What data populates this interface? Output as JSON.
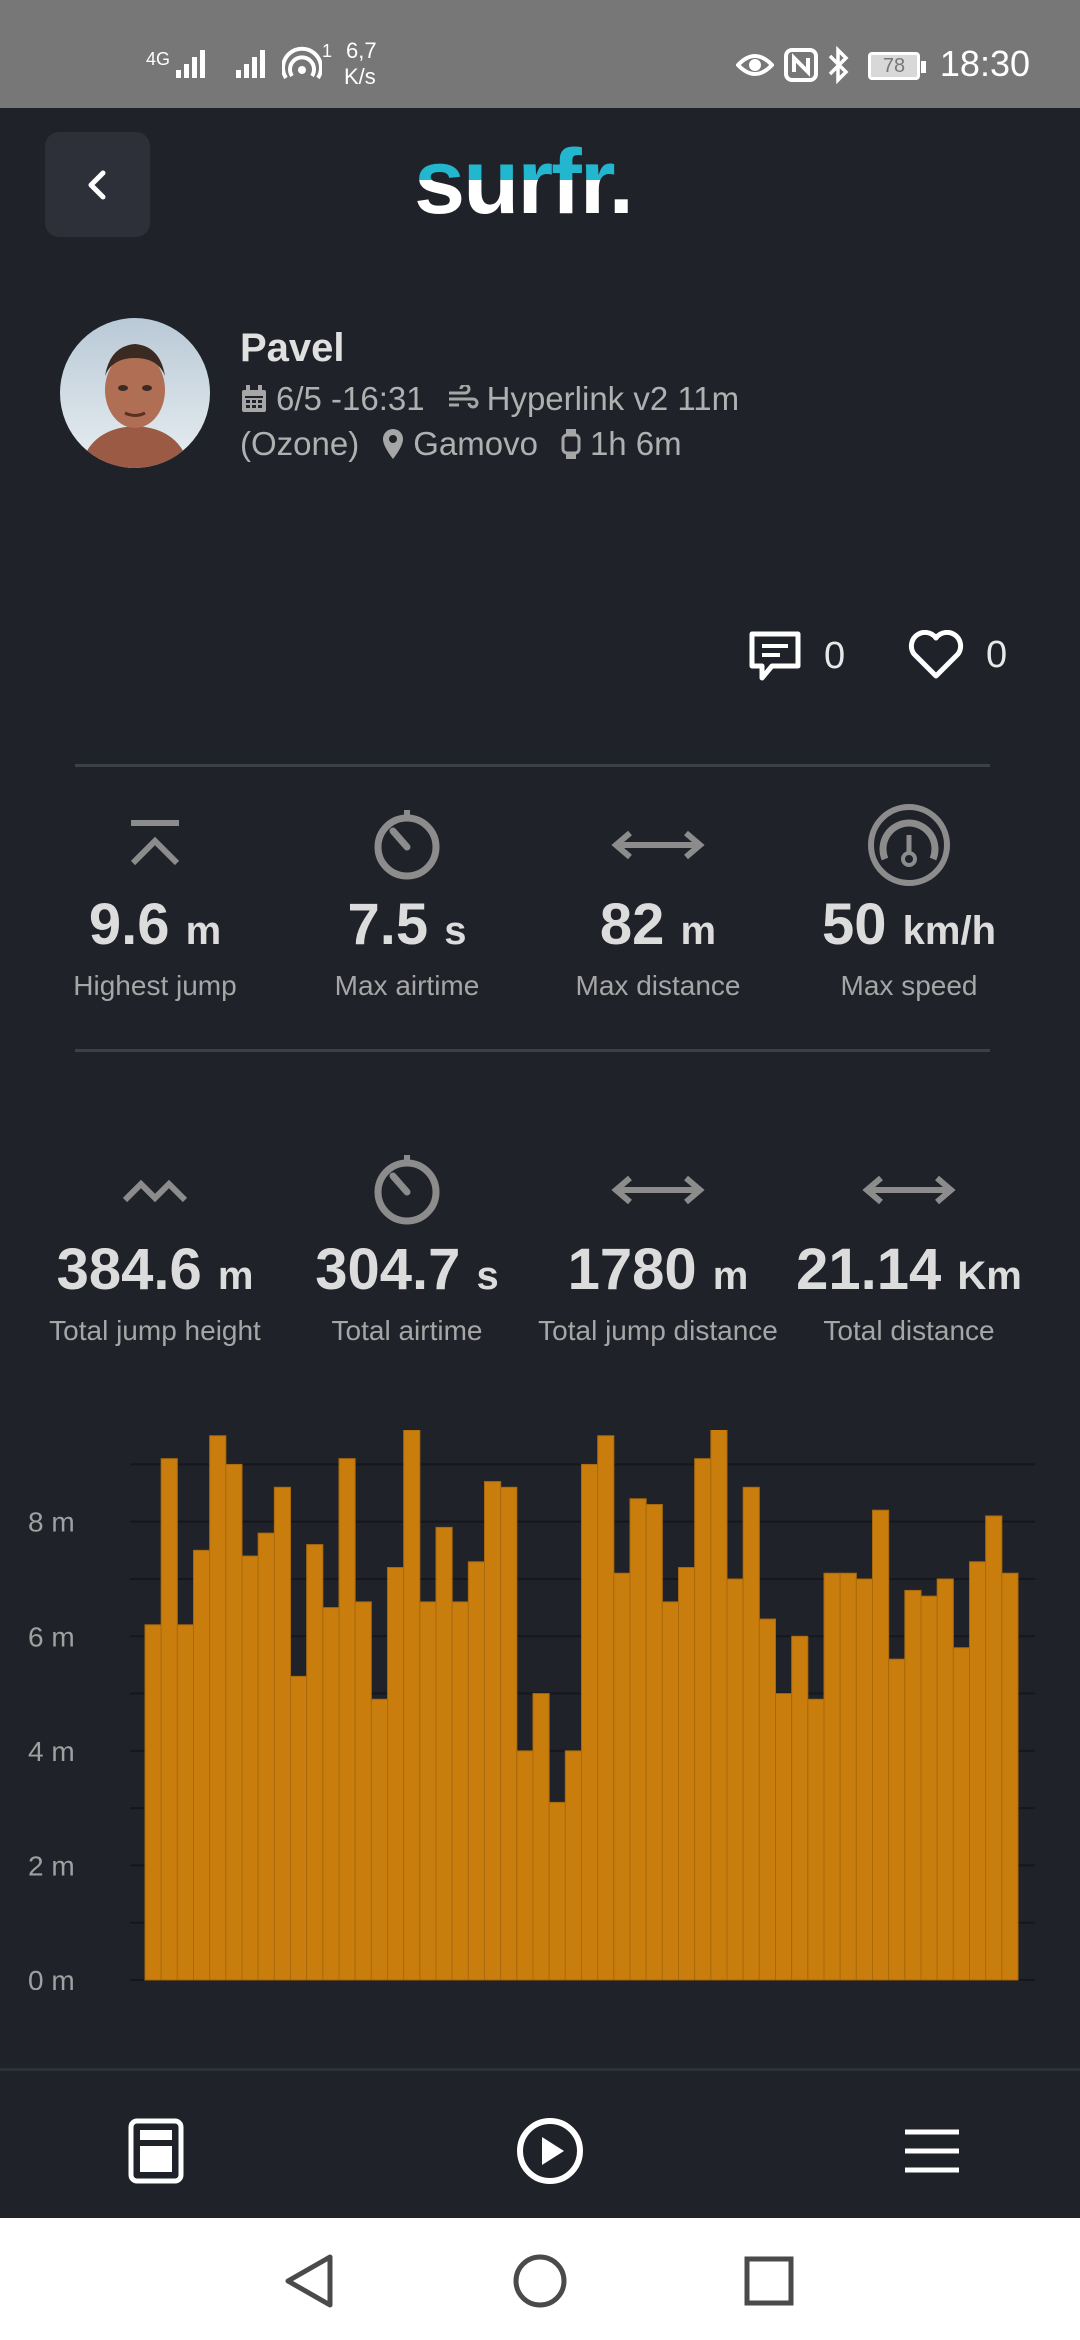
{
  "status_bar": {
    "network_1": "4G",
    "network_sim": "1",
    "hotspot_count": "1",
    "speed_value": "6,7",
    "speed_unit": "K/s",
    "battery": "78",
    "time": "18:30"
  },
  "header": {
    "logo_text": "surfr."
  },
  "session": {
    "user_name": "Pavel",
    "date_time": "6/5 -16:31",
    "kite": "Hyperlink v2 11m",
    "brand": "(Ozone)",
    "location": "Gamovo",
    "duration": "1h 6m"
  },
  "social": {
    "comments_count": "0",
    "likes_count": "0"
  },
  "stats_row_1": [
    {
      "icon": "jump-height-icon",
      "value": "9.6",
      "unit": "m",
      "label": "Highest jump"
    },
    {
      "icon": "timer-icon",
      "value": "7.5",
      "unit": "s",
      "label": "Max airtime"
    },
    {
      "icon": "distance-arrow-icon",
      "value": "82",
      "unit": "m",
      "label": "Max distance"
    },
    {
      "icon": "speedometer-icon",
      "value": "50",
      "unit": "km/h",
      "label": "Max speed"
    }
  ],
  "stats_row_2": [
    {
      "icon": "total-jump-icon",
      "value": "384.6",
      "unit": "m",
      "label": "Total jump height"
    },
    {
      "icon": "timer-icon",
      "value": "304.7",
      "unit": "s",
      "label": "Total airtime"
    },
    {
      "icon": "distance-arrow-icon",
      "value": "1780",
      "unit": "m",
      "label": "Total jump distance"
    },
    {
      "icon": "distance-arrow-icon",
      "value": "21.14",
      "unit": "Km",
      "label": "Total distance"
    }
  ],
  "colors": {
    "background": "#1f2229",
    "accent": "#23b6cf",
    "bar": "#c97d0c"
  },
  "chart_data": {
    "type": "bar",
    "title": "",
    "xlabel": "",
    "ylabel": "",
    "yticks": [
      "0 m",
      "2 m",
      "4 m",
      "6 m",
      "8 m"
    ],
    "ylim": [
      0,
      9.6
    ],
    "grid": true,
    "series": [
      {
        "values": [
          6.2,
          9.1,
          6.2,
          7.5,
          9.5,
          9.0,
          7.4,
          7.8,
          8.6,
          5.3,
          7.6,
          6.5,
          9.1,
          6.6,
          4.9,
          7.2,
          9.6,
          6.6,
          7.9,
          6.6,
          7.3,
          8.7,
          8.6,
          4.0,
          5.0,
          3.1,
          4.0,
          9.0,
          9.5,
          7.1,
          8.4,
          8.3,
          6.6,
          7.2,
          9.1,
          9.7,
          7.0,
          8.6,
          6.3,
          5.0,
          6.0,
          4.9,
          7.1,
          7.1,
          7.0,
          8.2,
          5.6,
          6.8,
          6.7,
          7.0,
          5.8,
          7.3,
          8.1,
          7.1
        ]
      }
    ]
  },
  "bottom_nav": {
    "items": [
      "sessions-tab",
      "play-tab",
      "menu-tab"
    ]
  }
}
